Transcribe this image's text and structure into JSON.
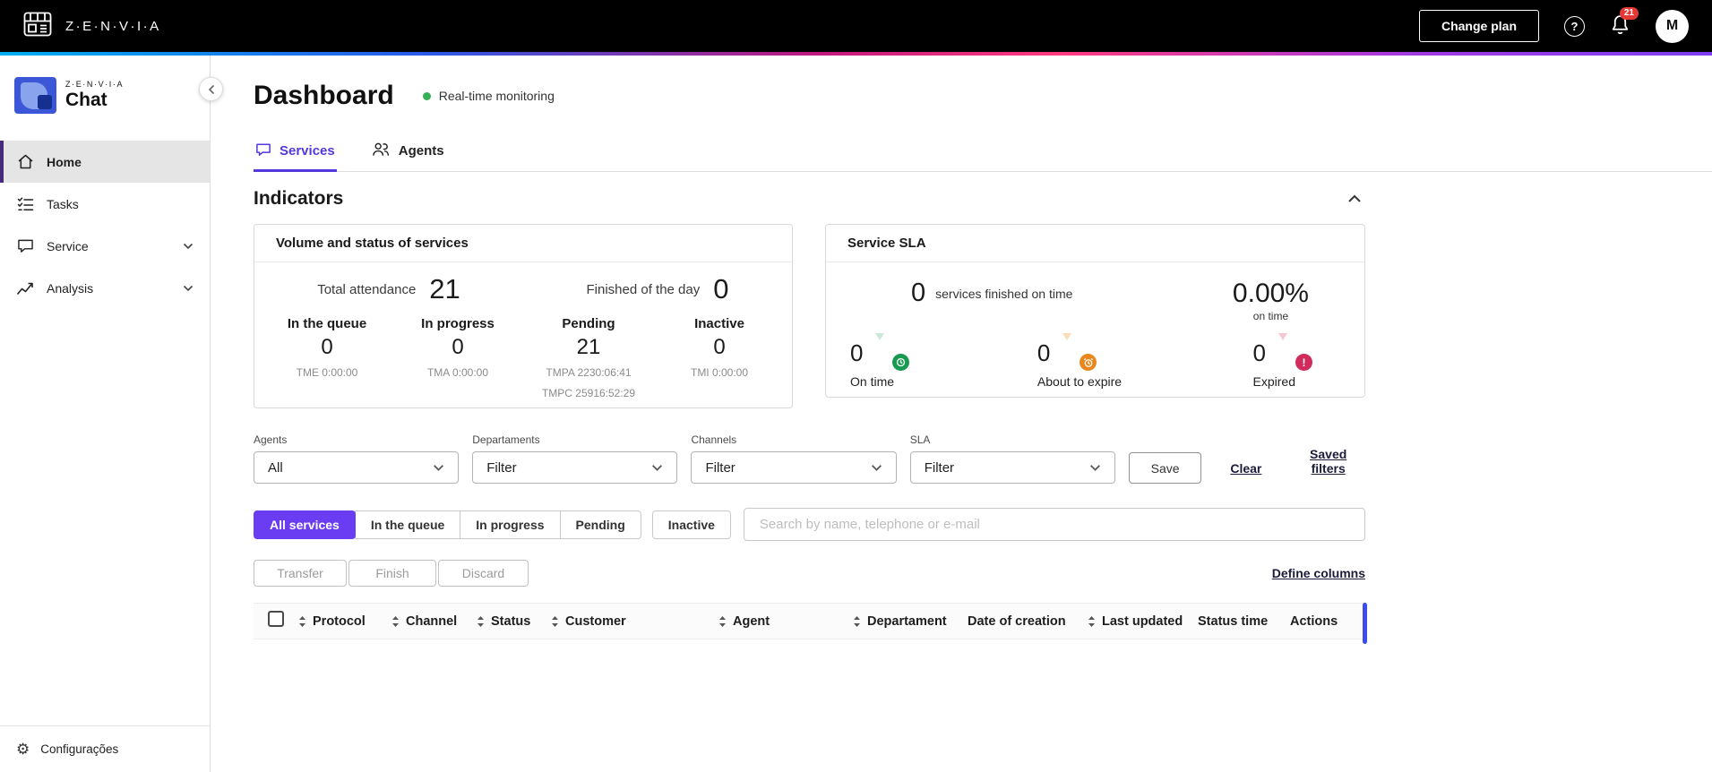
{
  "colors": {
    "accent_purple": "#6b3df2",
    "tab_purple": "#5438dc",
    "monitor_green": "#35b053",
    "sla_green": "#189a50",
    "sla_orange": "#e8881c",
    "sla_red": "#d12b5e",
    "badge_red": "#e53935",
    "scrollbar_blue": "#3f4bed"
  },
  "topbar": {
    "brand": "Z·E·N·V·I·A",
    "change_plan_label": "Change plan",
    "notification_count": "21",
    "avatar_initial": "M"
  },
  "sidebar": {
    "logo_top": "Z·E·N·V·I·A",
    "logo_bottom": "Chat",
    "items": [
      {
        "label": "Home"
      },
      {
        "label": "Tasks"
      },
      {
        "label": "Service"
      },
      {
        "label": "Analysis"
      }
    ],
    "footer_label": "Configurações"
  },
  "page": {
    "title": "Dashboard",
    "monitoring_label": "Real-time monitoring"
  },
  "tabs": [
    {
      "label": "Services"
    },
    {
      "label": "Agents"
    }
  ],
  "indicators": {
    "title": "Indicators",
    "volume_card": {
      "title": "Volume and status of services",
      "total_attendance_label": "Total attendance",
      "total_attendance_value": "21",
      "finished_label": "Finished of the day",
      "finished_value": "0",
      "stats": [
        {
          "label": "In the queue",
          "value": "0",
          "sub1": "TME 0:00:00"
        },
        {
          "label": "In progress",
          "value": "0",
          "sub1": "TMA 0:00:00"
        },
        {
          "label": "Pending",
          "value": "21",
          "sub1": "TMPA 2230:06:41",
          "sub2": "TMPC 25916:52:29"
        },
        {
          "label": "Inactive",
          "value": "0",
          "sub1": "TMI 0:00:00"
        }
      ]
    },
    "sla_card": {
      "title": "Service SLA",
      "finished_value": "0",
      "finished_label": "services finished on time",
      "percent_value": "0.00%",
      "percent_label": "on time",
      "stats": [
        {
          "value": "0",
          "label": "On time"
        },
        {
          "value": "0",
          "label": "About to expire"
        },
        {
          "value": "0",
          "label": "Expired"
        }
      ]
    }
  },
  "filters": {
    "fields": [
      {
        "label": "Agents",
        "value": "All"
      },
      {
        "label": "Departaments",
        "value": "Filter"
      },
      {
        "label": "Channels",
        "value": "Filter"
      },
      {
        "label": "SLA",
        "value": "Filter"
      }
    ],
    "save_label": "Save",
    "clear_label": "Clear",
    "saved_filters_label": "Saved filters"
  },
  "service_filters": {
    "tabs": [
      {
        "label": "All services"
      },
      {
        "label": "In the queue"
      },
      {
        "label": "In progress"
      },
      {
        "label": "Pending"
      },
      {
        "label": "Inactive"
      }
    ],
    "search_placeholder": "Search by name, telephone or e-mail"
  },
  "bulk_actions": {
    "transfer_label": "Transfer",
    "finish_label": "Finish",
    "discard_label": "Discard",
    "define_columns_label": "Define columns"
  },
  "table": {
    "columns": [
      {
        "label": "Protocol"
      },
      {
        "label": "Channel"
      },
      {
        "label": "Status"
      },
      {
        "label": "Customer"
      },
      {
        "label": "Agent"
      },
      {
        "label": "Departament"
      },
      {
        "label": "Date of creation"
      },
      {
        "label": "Last updated"
      },
      {
        "label": "Status time"
      },
      {
        "label": "Actions"
      }
    ]
  }
}
